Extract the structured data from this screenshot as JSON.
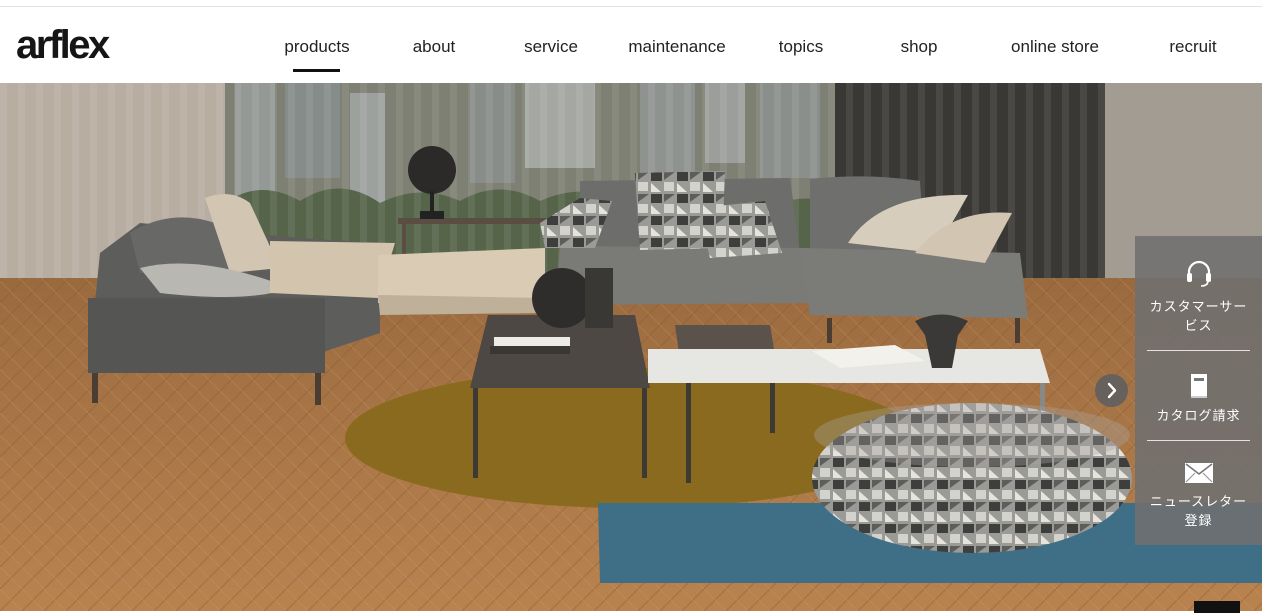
{
  "header": {
    "logo": "arflex",
    "nav": [
      {
        "label": "products",
        "active": true
      },
      {
        "label": "about"
      },
      {
        "label": "service"
      },
      {
        "label": "maintenance"
      },
      {
        "label": "topics"
      },
      {
        "label": "shop"
      },
      {
        "label": "online store"
      },
      {
        "label": "recruit"
      }
    ]
  },
  "side_panel": {
    "items": [
      {
        "label_line1": "カスタマーサー",
        "label_line2": "ビス",
        "icon": "headset-icon"
      },
      {
        "label_line1": "カタログ請求",
        "icon": "catalog-icon"
      },
      {
        "label_line1": "ニュースレター",
        "label_line2": "登録",
        "icon": "envelope-icon"
      }
    ]
  },
  "slider": {
    "next_icon": "chevron-right-icon"
  },
  "colors": {
    "panel": "#707070",
    "floor": "#b07a46",
    "rug_mustard": "#8a6a1e",
    "rug_blue": "#3f6f86"
  }
}
